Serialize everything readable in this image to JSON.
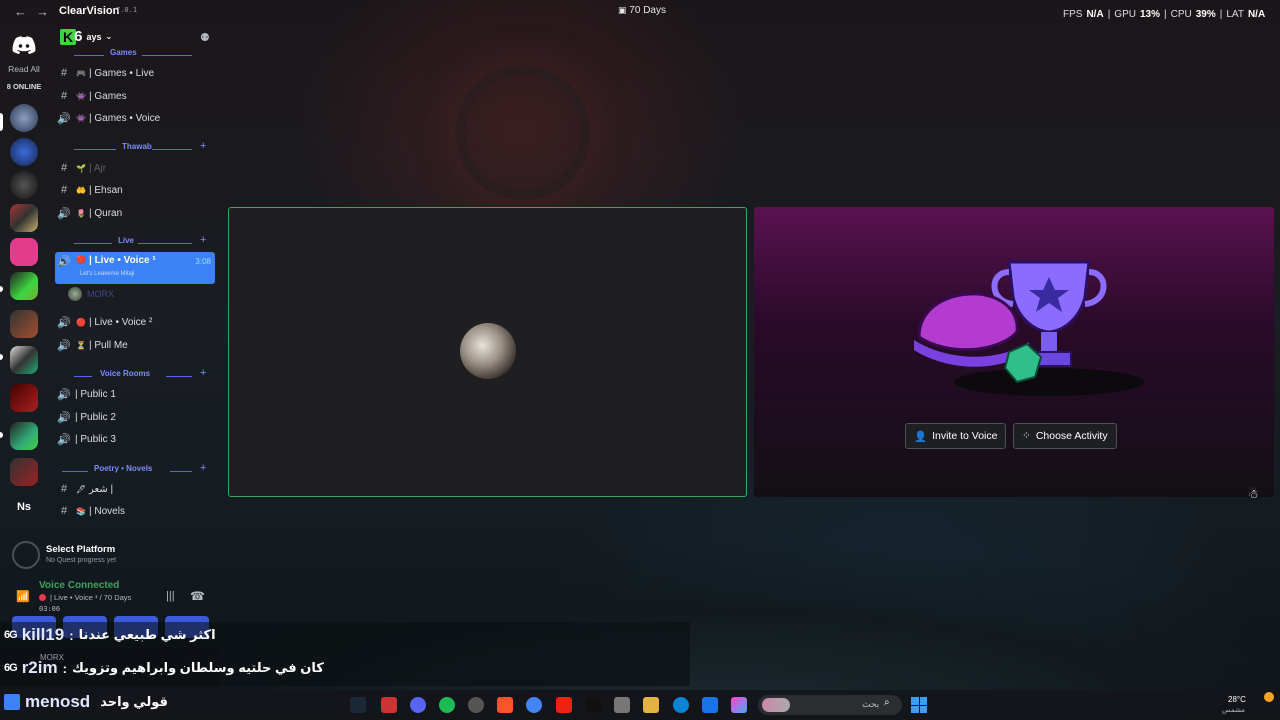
{
  "window": {
    "app_name": "ClearVision",
    "version": "7.0.1",
    "center_title": "70 Days",
    "stats": {
      "fps_label": "FPS",
      "fps_value": "N/A",
      "gpu_label": "GPU",
      "gpu_value": "13%",
      "cpu_label": "CPU",
      "cpu_value": "39%",
      "lat_label": "LAT",
      "lat_value": "N/A"
    }
  },
  "rail": {
    "read_all": "Read All",
    "online": "8 ONLINE",
    "bottom_label": "Ns"
  },
  "server": {
    "badge": "K",
    "badge_num": "6",
    "name_suffix": "ays"
  },
  "categories": {
    "games": "Games",
    "thawab": "Thawab",
    "live": "Live",
    "voice_rooms": "Voice Rooms",
    "poetry": "Poetry • Novels"
  },
  "channels": {
    "games_live": "| Games • Live",
    "games": "| Games",
    "games_voice": "| Games • Voice",
    "ajr": "| Ajr",
    "ehsan": "| Ehsan",
    "quran": "| Quran",
    "live_voice1": "| Live • Voice ¹",
    "live_voice1_time": "3:08",
    "live_voice1_sub": "Let's Leaveme Mitaji",
    "live_voice1_member": "MORX",
    "live_voice2": "| Live • Voice ²",
    "pull_me": "| Pull Me",
    "public1": "| Public 1",
    "public2": "| Public 2",
    "public3": "| Public 3",
    "poetry": "شعر |",
    "novels": "| Novels"
  },
  "activity": {
    "invite": "Invite to Voice",
    "choose": "Choose Activity"
  },
  "quest": {
    "title": "Select Platform",
    "subtitle": "No Quest progress yet"
  },
  "voice": {
    "status": "Voice Connected",
    "channel": "| Live • Voice ¹ / 70 Days",
    "time": "03:06"
  },
  "chat": [
    {
      "badge": "6G",
      "user": "kill19",
      "sep": ":",
      "msg": "اكثر شي طبيعي عندنا"
    },
    {
      "badge": "6G",
      "user": "r2im",
      "sep": ":",
      "msg": "كان في حلتيه وسلطان وابراهيم وتزويك"
    },
    {
      "badge": "",
      "user": "menosd",
      "sep": "",
      "msg": "قولي واحد"
    }
  ],
  "chat_member": "MORX",
  "taskbar": {
    "search": "بحث",
    "temp": "28°C",
    "weather": "مشمس"
  },
  "colors": {
    "accent": "#5865f2",
    "voice_green": "#3ba55d",
    "active_channel": "#3b82f6",
    "live_red": "#e8384f"
  }
}
